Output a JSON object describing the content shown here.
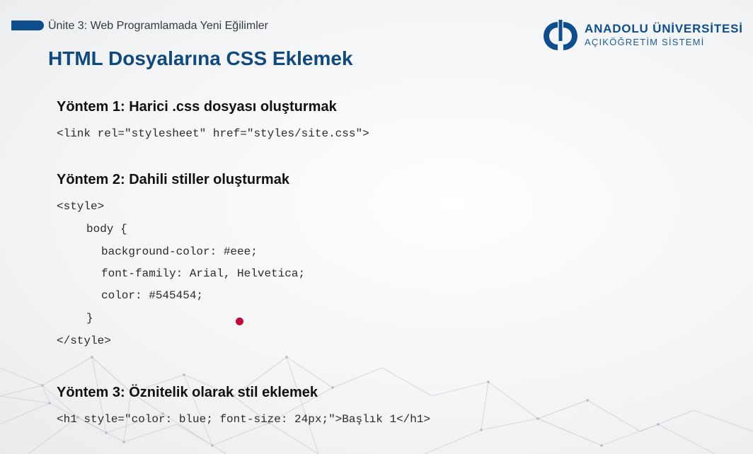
{
  "header": {
    "unit_title": "Ünite 3: Web Programlamada Yeni Eğilimler",
    "logo": {
      "line1": "ANADOLU ÜNİVERSİTESİ",
      "line2": "AÇIKÖĞRETİM SİSTEMİ"
    },
    "accent_color": "#0e4e8c"
  },
  "slide": {
    "title": "HTML Dosyalarına CSS Eklemek",
    "method1": {
      "title": "Yöntem 1: Harici .css dosyası oluşturmak",
      "code": "<link rel=\"stylesheet\" href=\"styles/site.css\">"
    },
    "method2": {
      "title": "Yöntem 2: Dahili stiller oluşturmak",
      "code_lines": [
        "<style>",
        "body {",
        "background-color: #eee;",
        "font-family: Arial, Helvetica;",
        "color: #545454;",
        "}",
        "</style>"
      ]
    },
    "method3": {
      "title": "Yöntem 3: Öznitelik olarak stil eklemek",
      "code": "<h1 style=\"color: blue; font-size: 24px;\">Başlık 1</h1>"
    }
  }
}
